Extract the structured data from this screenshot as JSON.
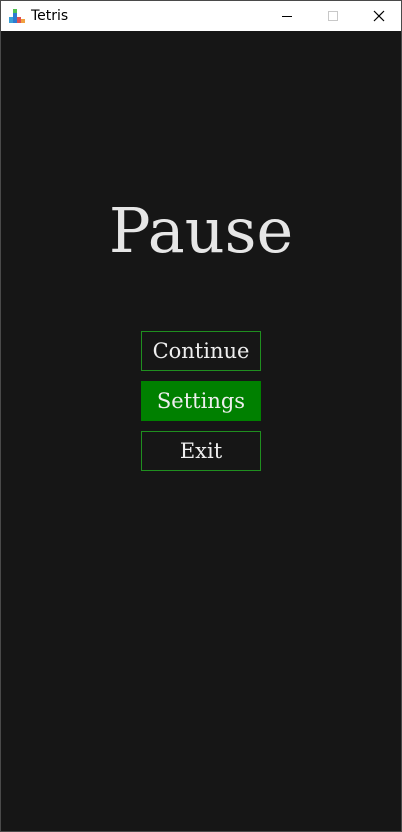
{
  "window": {
    "title": "Tetris",
    "app_icon": "tetris-blocks-icon",
    "controls": {
      "minimize_icon": "minimize-icon",
      "maximize_icon": "maximize-icon",
      "close_icon": "close-icon"
    }
  },
  "pause_menu": {
    "title": "Pause",
    "buttons": [
      {
        "label": "Continue",
        "selected": false
      },
      {
        "label": "Settings",
        "selected": true
      },
      {
        "label": "Exit",
        "selected": false
      }
    ]
  },
  "colors": {
    "background": "#161616",
    "accent_green": "#008000",
    "border_green": "#1f8f1f",
    "text": "#e6e6e6"
  }
}
